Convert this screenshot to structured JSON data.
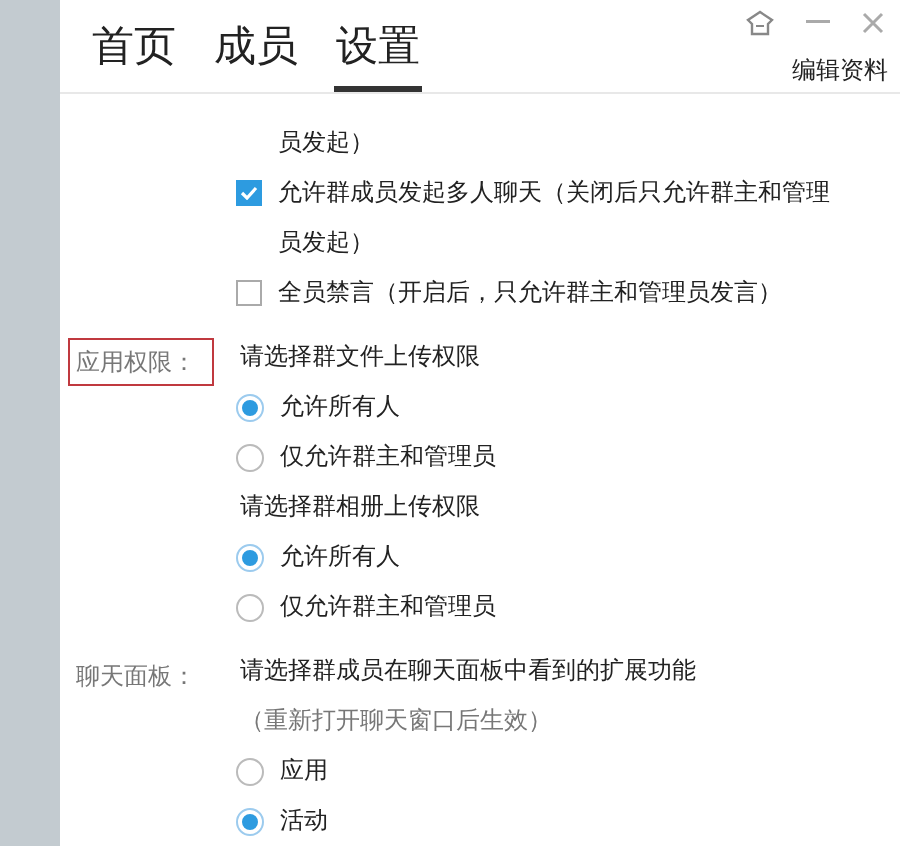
{
  "tabs": [
    {
      "label": "首页",
      "selected": false
    },
    {
      "label": "成员",
      "selected": false
    },
    {
      "label": "设置",
      "selected": true
    }
  ],
  "edit_profile": "编辑资料",
  "sections": [
    {
      "items": [
        {
          "kind": "continuation",
          "text": "员发起）"
        },
        {
          "kind": "checkbox",
          "text": "允许群成员发起多人聊天（关闭后只允许群主和管理员发起）",
          "checked": true
        },
        {
          "kind": "checkbox",
          "text": "全员禁言（开启后，只允许群主和管理员发言）",
          "checked": false
        }
      ]
    },
    {
      "label": "应用权限：",
      "highlighted": true,
      "items": [
        {
          "kind": "title",
          "text": "请选择群文件上传权限"
        },
        {
          "kind": "radio",
          "text": "允许所有人",
          "selected": true
        },
        {
          "kind": "radio",
          "text": "仅允许群主和管理员",
          "selected": false
        },
        {
          "kind": "title",
          "text": "请选择群相册上传权限"
        },
        {
          "kind": "radio",
          "text": "允许所有人",
          "selected": true
        },
        {
          "kind": "radio",
          "text": "仅允许群主和管理员",
          "selected": false
        }
      ]
    },
    {
      "label": "聊天面板：",
      "highlighted": false,
      "items": [
        {
          "kind": "title",
          "text": "请选择群成员在聊天面板中看到的扩展功能"
        },
        {
          "kind": "hint",
          "text": "（重新打开聊天窗口后生效）"
        },
        {
          "kind": "radio",
          "text": "应用",
          "selected": false
        },
        {
          "kind": "radio",
          "text": "活动",
          "selected": true
        }
      ]
    }
  ]
}
